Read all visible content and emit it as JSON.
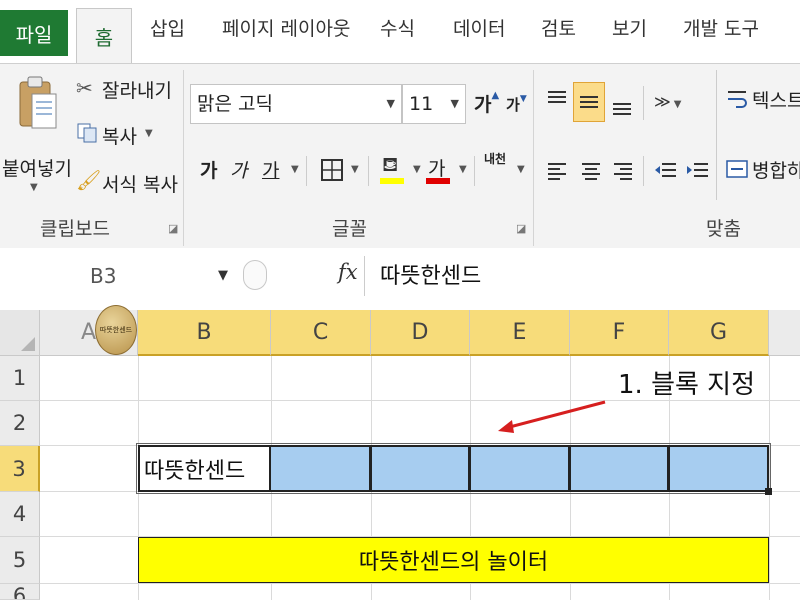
{
  "tabs": {
    "file": "파일",
    "home": "홈",
    "insert": "삽입",
    "page_layout": "페이지 레이아웃",
    "formulas": "수식",
    "data": "데이터",
    "review": "검토",
    "view": "보기",
    "developer": "개발 도구"
  },
  "clipboard": {
    "paste": "붙여넣기",
    "cut": "잘라내기",
    "copy": "복사",
    "format_painter": "서식 복사",
    "group_label": "클립보드"
  },
  "font": {
    "family": "맑은 고딕",
    "size": "11",
    "grow": "가",
    "shrink": "가",
    "bold": "가",
    "italic": "가",
    "underline": "가",
    "font_color_glyph": "가",
    "phonetic": "내천",
    "group_label": "글꼴"
  },
  "alignment": {
    "wrap_text": "텍스트",
    "merge": "병합하",
    "group_label": "맞춤"
  },
  "formula_bar": {
    "name_box": "B3",
    "fx": "fx",
    "value": "따뜻한센드"
  },
  "sheet": {
    "columns": [
      "A",
      "B",
      "C",
      "D",
      "E",
      "F",
      "G"
    ],
    "rows": [
      "1",
      "2",
      "3",
      "4",
      "5",
      "6"
    ],
    "b3": "따뜻한센드",
    "b5_merged": "따뜻한센드의 놀이터",
    "selection_color": "#a7cdf0",
    "banner_color": "#ffff00"
  },
  "annotation": {
    "text": "1. 블록 지정",
    "arrow_color": "#d61f1f"
  },
  "watermark": {
    "text": "따뜻한센드"
  }
}
